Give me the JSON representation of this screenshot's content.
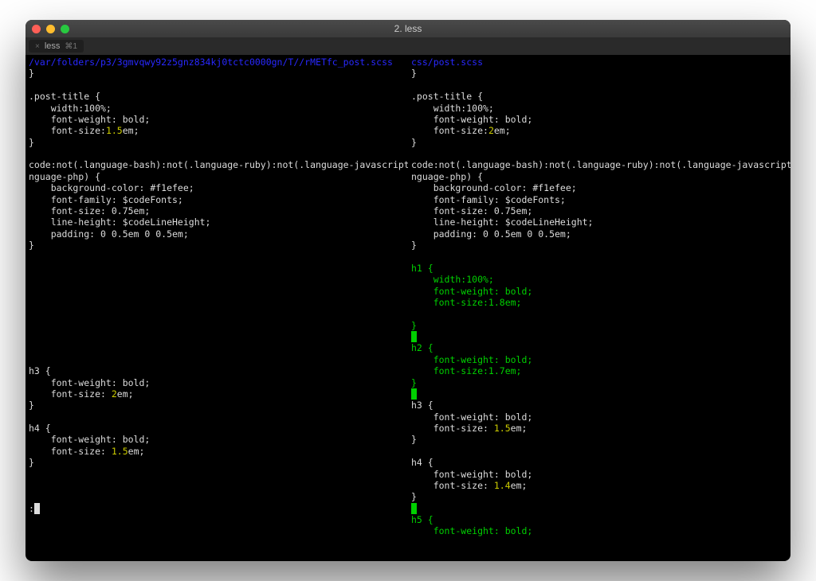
{
  "window": {
    "title": "2. less"
  },
  "tab": {
    "close": "×",
    "label": "less",
    "shortcut": "⌘1"
  },
  "left": {
    "path": "/var/folders/p3/3gmvqwy92z5gnz834kj0tctc0000gn/T//rMETfc_post.scss",
    "brace_close": "}",
    "blank": "",
    "post_title_open": ".post-title {",
    "width": "    width:100%;",
    "fw_bold": "    font-weight: bold;",
    "fs_pre": "    font-size:",
    "fs_val": "1.5",
    "fs_post": "em;",
    "code1": "code:not(.language-bash):not(.language-ruby):not(.language-javascript):not(.la",
    "code2": "nguage-php) {",
    "bg": "    background-color: #f1efee;",
    "ff": "    font-family: $codeFonts;",
    "fs075": "    font-size: 0.75em;",
    "lh": "    line-height: $codeLineHeight;",
    "pad": "    padding: 0 0.5em 0 0.5em;",
    "h3_open": "h3 {",
    "h3_fw": "    font-weight: bold;",
    "h3_fs_pre": "    font-size: ",
    "h3_fs_val": "2",
    "h3_fs_post": "em;",
    "h4_open": "h4 {",
    "h4_fw": "    font-weight: bold;",
    "h4_fs_pre": "    font-size: ",
    "h4_fs_val": "1.5",
    "h4_fs_post": "em;",
    "prompt": ":"
  },
  "right": {
    "path": "css/post.scss",
    "brace_close": "}",
    "blank": "",
    "post_title_open": ".post-title {",
    "width": "    width:100%;",
    "fw_bold": "    font-weight: bold;",
    "fs_pre": "    font-size:",
    "fs_val": "2",
    "fs_post": "em;",
    "code1": "code:not(.language-bash):not(.language-ruby):not(.language-javascript):not(.la",
    "code2": "nguage-php) {",
    "bg": "    background-color: #f1efee;",
    "ff": "    font-family: $codeFonts;",
    "fs075": "    font-size: 0.75em;",
    "lh": "    line-height: $codeLineHeight;",
    "pad": "    padding: 0 0.5em 0 0.5em;",
    "h1_open": "h1 {",
    "h1_width": "    width:100%;",
    "h1_fw": "    font-weight: bold;",
    "h1_fs": "    font-size:1.8em;",
    "h2_open": "h2 {",
    "h2_fw": "    font-weight: bold;",
    "h2_fs": "    font-size:1.7em;",
    "h3_open": "h3 {",
    "h3_fw": "    font-weight: bold;",
    "h3_fs_pre": "    font-size: ",
    "h3_fs_val": "1.5",
    "h3_fs_post": "em;",
    "h4_open": "h4 {",
    "h4_fw": "    font-weight: bold;",
    "h4_fs_pre": "    font-size: ",
    "h4_fs_val": "1.4",
    "h4_fs_post": "em;",
    "h5_open": "h5 {",
    "h5_fw": "    font-weight: bold;"
  }
}
